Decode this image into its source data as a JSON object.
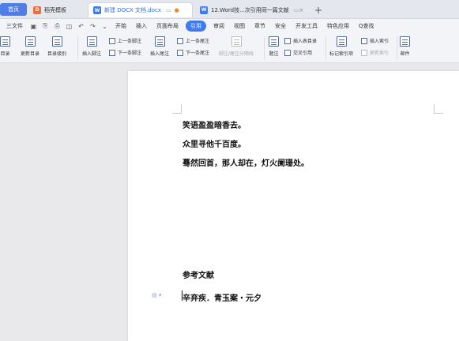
{
  "tabs": [
    {
      "label": "首页"
    },
    {
      "label": "稻壳模板"
    },
    {
      "label": "新建 DOCX 文档.docx"
    },
    {
      "label": "12.Word技...次引用同一篇文献"
    }
  ],
  "menu": {
    "file": "三文件",
    "items": [
      "开始",
      "插入",
      "页面布局",
      "引用",
      "审阅",
      "视图",
      "章节",
      "安全",
      "开发工具",
      "特色应用"
    ],
    "search": "Q查找"
  },
  "ribbon": {
    "toc": "目录",
    "update_toc": "更新目录",
    "toc_level": "目录级别",
    "insert_footnote": "插入脚注",
    "prev_footnote": "上一条脚注",
    "next_footnote": "下一条脚注",
    "insert_endnote": "插入尾注",
    "prev_endnote": "上一条尾注",
    "next_endnote": "下一条尾注",
    "separator": "脚注/尾注分隔线",
    "caption": "题注",
    "insert_table_toc": "插入表目录",
    "cross_ref": "交叉引用",
    "mark_index": "标记索引项",
    "insert_index": "插入索引",
    "update_index": "更新索引",
    "mail": "邮件"
  },
  "document": {
    "lines": [
      "笑语盈盈暗香去。",
      "众里寻他千百度。",
      "蓦然回首，那人却在，灯火阑珊处。"
    ],
    "ref_heading": "参考文献",
    "ref_entry": "辛弃疾．青玉案・元夕"
  },
  "colors": {
    "accent": "#3f7af0",
    "home_tab": "#4f7ee8"
  }
}
